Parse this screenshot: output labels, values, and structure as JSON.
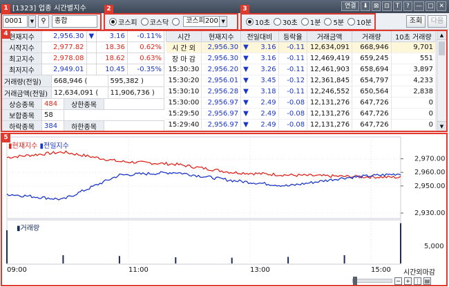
{
  "window": {
    "title": "[1323] 업종 시간별지수",
    "buttons": [
      "연결",
      "⬇",
      "⊠",
      "⊡",
      "T",
      "?",
      "—",
      "□",
      "✕"
    ]
  },
  "badges": [
    "1",
    "2",
    "3",
    "4",
    "5"
  ],
  "toolbar": {
    "code": "0001",
    "name": "종합",
    "market_options": [
      {
        "label": "코스피",
        "selected": true
      },
      {
        "label": "코스닥",
        "selected": false
      }
    ],
    "index_select": "코스피200",
    "interval_options": [
      {
        "label": "10초",
        "selected": true
      },
      {
        "label": "30초",
        "selected": false
      },
      {
        "label": "1분",
        "selected": false
      },
      {
        "label": "5분",
        "selected": false
      },
      {
        "label": "10분",
        "selected": false
      }
    ],
    "query_button": "조회",
    "next_button": "다음"
  },
  "summary": {
    "rows": [
      {
        "label": "현재지수",
        "value": "2,956.30",
        "arrow": "▼",
        "change": "3.16",
        "pct": "-0.11%",
        "color": "blue"
      },
      {
        "label": "시작지수",
        "value": "2,977.82",
        "arrow": "",
        "change": "18.36",
        "pct": "0.62%",
        "color": "red"
      },
      {
        "label": "최고지수",
        "value": "2,978.08",
        "arrow": "",
        "change": "18.62",
        "pct": "0.63%",
        "color": "red"
      },
      {
        "label": "최저지수",
        "value": "2,949.01",
        "arrow": "",
        "change": "10.45",
        "pct": "-0.35%",
        "color": "blue"
      }
    ],
    "volume_label": "거래량(전일)",
    "volume_value": "668,946 (",
    "volume_prev": "595,382 )",
    "amount_label": "거래금액(전일)",
    "amount_value": "12,634,091 (",
    "amount_prev": "11,906,736 )",
    "breadth": [
      {
        "label": "상승종목",
        "value": "484",
        "color": "red",
        "label2": "상한종목",
        "value2": ""
      },
      {
        "label": "보합종목",
        "value": "58",
        "color": "black",
        "label2": "",
        "value2": ""
      },
      {
        "label": "하락종목",
        "value": "384",
        "color": "blue",
        "label2": "하한종목",
        "value2": ""
      }
    ]
  },
  "table": {
    "headers": [
      "시간",
      "현재지수",
      "전일대비",
      "등락율",
      "거래금액",
      "거래량",
      "10초 거래량"
    ],
    "rows": [
      {
        "time": "시 간 외",
        "index": "2,956.30",
        "arrow": "▼",
        "diff": "3.16",
        "rate": "-0.11",
        "amount": "12,634,091",
        "volume": "668,946",
        "v10": "9,701",
        "hl": true
      },
      {
        "time": "장 마 감",
        "index": "2,956.30",
        "arrow": "▼",
        "diff": "3.16",
        "rate": "-0.11",
        "amount": "12,469,419",
        "volume": "659,245",
        "v10": "551",
        "hl": false
      },
      {
        "time": "15:30:30",
        "index": "2,956.20",
        "arrow": "▼",
        "diff": "3.26",
        "rate": "-0.11",
        "amount": "12,461,903",
        "volume": "658,694",
        "v10": "3,897",
        "hl": false
      },
      {
        "time": "15:30:20",
        "index": "2,956.01",
        "arrow": "▼",
        "diff": "3.45",
        "rate": "-0.12",
        "amount": "12,361,845",
        "volume": "654,797",
        "v10": "4,233",
        "hl": false
      },
      {
        "time": "15:30:10",
        "index": "2,956.28",
        "arrow": "▼",
        "diff": "3.18",
        "rate": "-0.11",
        "amount": "12,246,552",
        "volume": "650,564",
        "v10": "2,838",
        "hl": false
      },
      {
        "time": "15:30:00",
        "index": "2,956.97",
        "arrow": "▼",
        "diff": "2.49",
        "rate": "-0.08",
        "amount": "12,131,276",
        "volume": "647,726",
        "v10": "0",
        "hl": false
      },
      {
        "time": "15:29:50",
        "index": "2,956.97",
        "arrow": "▼",
        "diff": "2.49",
        "rate": "-0.08",
        "amount": "12,131,276",
        "volume": "647,726",
        "v10": "0",
        "hl": false
      },
      {
        "time": "15:29:40",
        "index": "2,956.97",
        "arrow": "▼",
        "diff": "2.49",
        "rate": "-0.08",
        "amount": "12,131,276",
        "volume": "647,726",
        "v10": "0",
        "hl": false
      }
    ]
  },
  "chart": {
    "legend_current": "현재지수",
    "legend_prev": "전일지수",
    "volume_legend": "거래량",
    "y_ticks": [
      "2,970.00",
      "2,960.00",
      "2,950.00",
      "2,930.00"
    ],
    "volume_tick": "5,000",
    "time_ticks": [
      "09:00",
      "11:00",
      "13:00",
      "15:00"
    ],
    "after_hours_label": "시간외마감",
    "colors": {
      "current": "#e0251b",
      "prev": "#1a36c8",
      "volume": "#1a2a5a"
    }
  },
  "chart_data": {
    "type": "line",
    "x": [
      "09:00",
      "10:00",
      "11:00",
      "12:00",
      "13:00",
      "14:00",
      "15:00",
      "15:30"
    ],
    "series": [
      {
        "name": "현재지수",
        "values": [
          2971,
          2975,
          2968,
          2966,
          2960,
          2958,
          2957,
          2956.3
        ]
      },
      {
        "name": "전일지수",
        "values": [
          2944,
          2940,
          2958,
          2960,
          2954,
          2950,
          2956,
          2959
        ]
      }
    ],
    "ylim": [
      2928,
      2980
    ],
    "volume": {
      "name": "거래량",
      "values": [
        8000,
        2000,
        1800,
        1500,
        1400,
        1600,
        2000,
        9701
      ]
    }
  }
}
